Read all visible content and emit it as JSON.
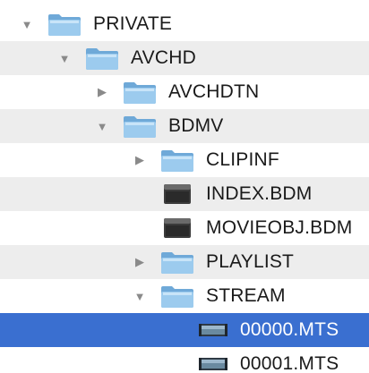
{
  "colors": {
    "selection": "#3a6fd0",
    "stripe": "#ededed",
    "folder": "#8fc3e8"
  },
  "tree": {
    "rows": [
      {
        "label": "PRIVATE",
        "disclosure": "expanded",
        "icon": "folder-icon"
      },
      {
        "label": "AVCHD",
        "disclosure": "expanded",
        "icon": "folder-icon"
      },
      {
        "label": "AVCHDTN",
        "disclosure": "collapsed",
        "icon": "folder-icon"
      },
      {
        "label": "BDMV",
        "disclosure": "expanded",
        "icon": "folder-icon"
      },
      {
        "label": "CLIPINF",
        "disclosure": "collapsed",
        "icon": "folder-icon"
      },
      {
        "label": "INDEX.BDM",
        "disclosure": "none",
        "icon": "file-icon"
      },
      {
        "label": "MOVIEOBJ.BDM",
        "disclosure": "none",
        "icon": "file-icon"
      },
      {
        "label": "PLAYLIST",
        "disclosure": "collapsed",
        "icon": "folder-icon"
      },
      {
        "label": "STREAM",
        "disclosure": "expanded",
        "icon": "folder-icon"
      },
      {
        "label": "00000.MTS",
        "disclosure": "none",
        "icon": "video-file-icon",
        "selected": true
      },
      {
        "label": "00001.MTS",
        "disclosure": "none",
        "icon": "video-file-icon"
      }
    ]
  }
}
